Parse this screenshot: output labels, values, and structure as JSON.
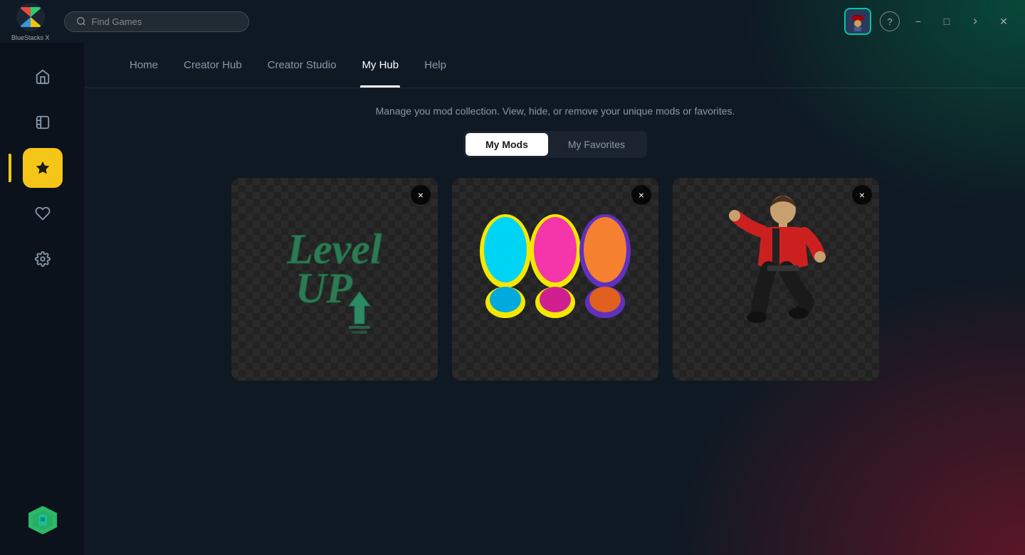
{
  "app": {
    "name": "BlueStacks X",
    "logo_text": "BlueStacks X"
  },
  "titlebar": {
    "search_placeholder": "Find Games",
    "help_label": "?",
    "minimize_label": "−",
    "maximize_label": "□",
    "navigate_label": "→",
    "close_label": "✕"
  },
  "sidebar": {
    "items": [
      {
        "id": "home",
        "icon": "home",
        "label": "Home"
      },
      {
        "id": "library",
        "icon": "library",
        "label": "Library"
      },
      {
        "id": "hub",
        "icon": "star",
        "label": "Hub",
        "active": true
      },
      {
        "id": "favorites",
        "icon": "heart",
        "label": "Favorites"
      },
      {
        "id": "settings",
        "icon": "settings",
        "label": "Settings"
      }
    ]
  },
  "nav": {
    "tabs": [
      {
        "id": "home",
        "label": "Home",
        "active": false
      },
      {
        "id": "creator-hub",
        "label": "Creator Hub",
        "active": false
      },
      {
        "id": "creator-studio",
        "label": "Creator Studio",
        "active": false
      },
      {
        "id": "my-hub",
        "label": "My Hub",
        "active": true
      },
      {
        "id": "help",
        "label": "Help",
        "active": false
      }
    ]
  },
  "content": {
    "subtitle": "Manage you mod collection. View, hide, or remove your unique mods or favorites.",
    "toggle": {
      "my_mods_label": "My Mods",
      "my_favorites_label": "My Favorites",
      "active": "my_mods"
    },
    "mods": [
      {
        "id": "mod1",
        "title": "Level UP",
        "type": "text"
      },
      {
        "id": "mod2",
        "title": "Colorful Marks",
        "type": "shapes"
      },
      {
        "id": "mod3",
        "title": "Dancing Figure",
        "type": "figure"
      }
    ],
    "close_label": "×"
  }
}
